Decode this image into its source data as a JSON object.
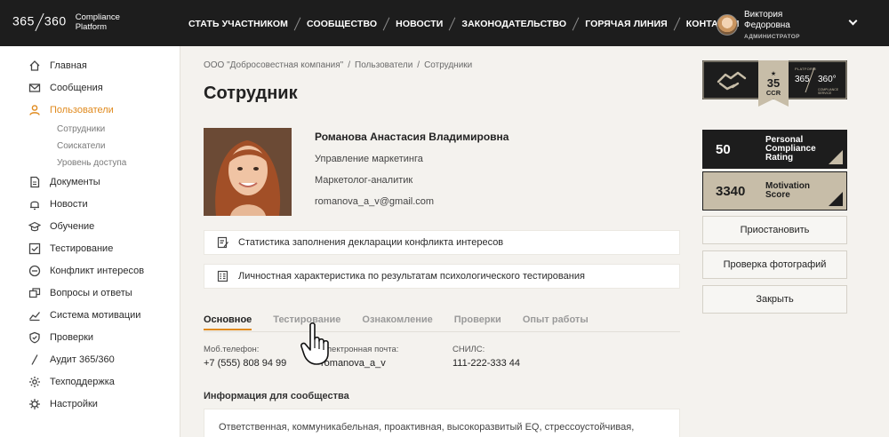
{
  "header": {
    "logo_num": "365",
    "logo_num2": "360",
    "logo_text_1": "Compliance",
    "logo_text_2": "Platform",
    "nav": [
      "СТАТЬ УЧАСТНИКОМ",
      "СООБЩЕСТВО",
      "НОВОСТИ",
      "ЗАКОНОДАТЕЛЬСТВО",
      "ГОРЯЧАЯ ЛИНИЯ",
      "КОНТАКТЫ"
    ],
    "user_first": "Виктория",
    "user_last": "Федоровна",
    "user_role": "АДМИНИСТРАТОР"
  },
  "sidebar": {
    "items": [
      {
        "label": "Главная",
        "icon": "home-icon"
      },
      {
        "label": "Сообщения",
        "icon": "mail-icon"
      },
      {
        "label": "Пользователи",
        "icon": "user-icon"
      },
      {
        "label": "Документы",
        "icon": "document-icon"
      },
      {
        "label": "Новости",
        "icon": "bell-icon"
      },
      {
        "label": "Обучение",
        "icon": "graduation-icon"
      },
      {
        "label": "Тестирование",
        "icon": "checkbox-icon"
      },
      {
        "label": "Конфликт интересов",
        "icon": "minus-circle-icon"
      },
      {
        "label": "Вопросы и ответы",
        "icon": "chat-icon"
      },
      {
        "label": "Система мотивации",
        "icon": "chart-icon"
      },
      {
        "label": "Проверки",
        "icon": "shield-icon"
      },
      {
        "label": "Аудит 365/360",
        "icon": "audit-icon"
      },
      {
        "label": "Техподдержка",
        "icon": "gear-icon"
      },
      {
        "label": "Настройки",
        "icon": "settings-icon"
      }
    ],
    "subitems": [
      "Сотрудники",
      "Соискатели",
      "Уровень доступа"
    ],
    "active_color": "#e08a1e"
  },
  "breadcrumb": [
    "ООО \"Добросовестная компания\"",
    "/",
    "Пользователи",
    "/",
    "Сотрудники"
  ],
  "page_title": "Сотрудник",
  "profile": {
    "name": "Романова Анастасия Владимировна",
    "department": "Управление маркетинга",
    "position": "Маркетолог-аналитик",
    "email": "romanova_a_v@gmail.com"
  },
  "actions": {
    "conflict_stats": "Статистика заполнения декларации конфликта интересов",
    "psych_profile": "Личностная характеристика по результатам психологического тестирования"
  },
  "tabs": [
    "Основное",
    "Тестирование",
    "Ознакомление",
    "Проверки",
    "Опыт работы"
  ],
  "fields": {
    "phone_label": "Моб.телефон:",
    "phone_value": "+7 (555) 808 94 99",
    "email_label": "Электронная почта:",
    "email_value": "romanova_a_v",
    "snils_label": "СНИЛС:",
    "snils_value": "111-222-333 44"
  },
  "community": {
    "title": "Информация для сообщества",
    "text": "Ответственная, коммуникабельная, проактивная, высокоразвитый EQ, стрессоустойчивая,"
  },
  "badges": {
    "ccr_number": "35",
    "ccr_label": "CCR",
    "platform_label": "PLATFORM",
    "platform_a": "365",
    "platform_b": "360°",
    "platform_sub": "COMPLIANCE SERVICE",
    "pcr_value": "50",
    "pcr_label_1": "Personal",
    "pcr_label_2": "Compliance",
    "pcr_label_3": "Rating",
    "motivation_value": "3340",
    "motivation_label_1": "Motivation",
    "motivation_label_2": "Score"
  },
  "buttons": {
    "suspend": "Приостановить",
    "photo_check": "Проверка фотографий",
    "close": "Закрыть"
  }
}
